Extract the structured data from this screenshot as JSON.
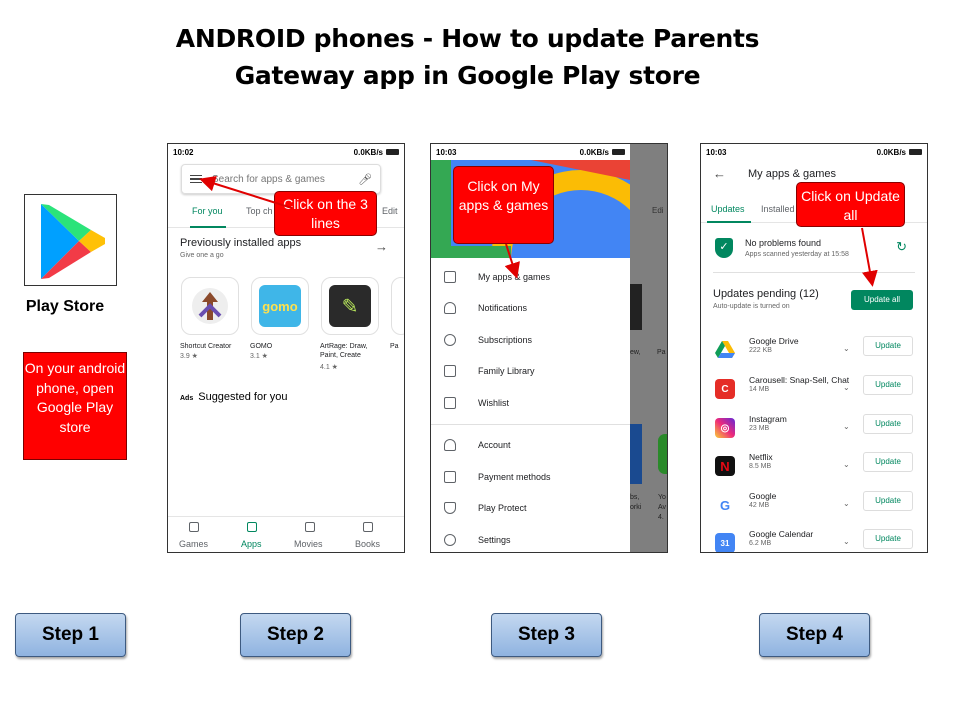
{
  "title_line1": "ANDROID phones - How to update Parents",
  "title_line2": "Gateway app in Google Play store",
  "playstore": {
    "label": "Play Store",
    "instruction": "On your android phone, open Google Play store"
  },
  "step1": "Step 1",
  "step2": "Step 2",
  "step3": "Step 3",
  "step4": "Step 4",
  "phone2": {
    "time": "10:02",
    "net": "0.0KB/s",
    "search_placeholder": "Search for apps & games",
    "tabs": [
      "For you",
      "Top ch",
      "Edit"
    ],
    "section_title": "Previously installed apps",
    "section_sub": "Give one a go",
    "apps": [
      {
        "name": "Shortcut Creator",
        "rating": "3.9 ★"
      },
      {
        "name": "GOMO",
        "rating": "3.1 ★"
      },
      {
        "name": "ArtRage: Draw, Paint, Create",
        "rating": "4.1 ★"
      },
      {
        "name": "Pa",
        "rating": ""
      }
    ],
    "ads_tag": "Ads",
    "ads_title": "Suggested for you",
    "nav": [
      "Games",
      "Apps",
      "Movies",
      "Books"
    ],
    "callout": "Click on the 3 lines"
  },
  "phone3": {
    "time": "10:03",
    "net": "0.0KB/s",
    "menu": [
      "My apps & games",
      "Notifications",
      "Subscriptions",
      "Family Library",
      "Wishlist",
      "Account",
      "Payment methods",
      "Play Protect",
      "Settings"
    ],
    "callout": "Click on My apps & games",
    "peek": [
      "Edi",
      "ew,",
      "Pa",
      "bs,",
      "orki",
      "Yo",
      "Av",
      "4."
    ]
  },
  "phone4": {
    "time": "10:03",
    "net": "0.0KB/s",
    "header": "My apps & games",
    "tabs": [
      "Updates",
      "Installed"
    ],
    "status_title": "No problems found",
    "status_sub": "Apps scanned yesterday at 15:58",
    "pending_title": "Updates pending (12)",
    "pending_sub": "Auto-update is turned on",
    "update_all": "Update all",
    "callout": "Click on Update all",
    "update_label": "Update",
    "apps": [
      {
        "name": "Google Drive",
        "size": "222 KB",
        "color": "#ffffff"
      },
      {
        "name": "Carousell: Snap-Sell, Chat",
        "size": "14 MB",
        "color": "#e52d27"
      },
      {
        "name": "Instagram",
        "size": "23 MB",
        "color": "#c13584"
      },
      {
        "name": "Netflix",
        "size": "8.5 MB",
        "color": "#111111"
      },
      {
        "name": "Google",
        "size": "42 MB",
        "color": "#ffffff"
      },
      {
        "name": "Google Calendar",
        "size": "6.2 MB",
        "color": "#4285f4"
      }
    ]
  }
}
